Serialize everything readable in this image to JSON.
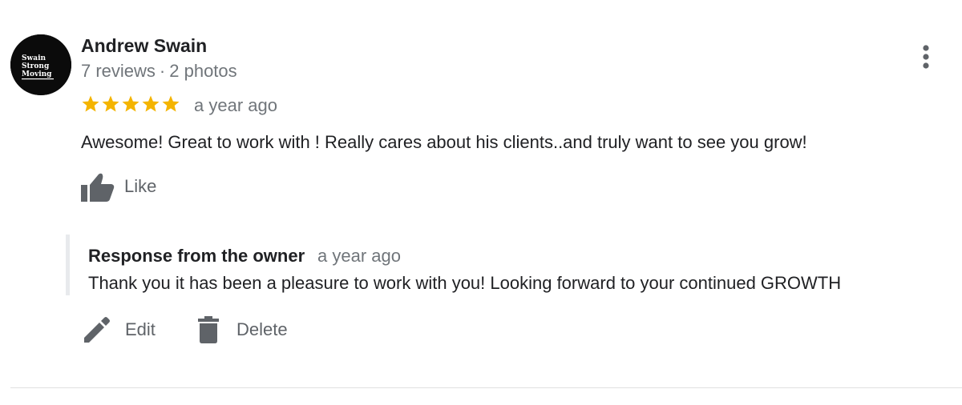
{
  "reviewer": {
    "name": "Andrew Swain",
    "reviews_count": "7 reviews",
    "separator": "·",
    "photos_count": "2 photos",
    "avatar_text": [
      "Swain",
      "Strong",
      "Moving"
    ]
  },
  "review": {
    "rating": 5,
    "rating_max": 5,
    "time": "a year ago",
    "text": "Awesome! Great to work with ! Really cares about his clients..and truly want to see you grow!"
  },
  "actions": {
    "like_label": "Like",
    "edit_label": "Edit",
    "delete_label": "Delete"
  },
  "owner_response": {
    "title": "Response from the owner",
    "time": "a year ago",
    "text": "Thank you it has been a pleasure to work with you! Looking forward to your continued GROWTH"
  },
  "icons": {
    "avatar": "brand-logo",
    "more": "more-vert-icon",
    "star": "star-icon",
    "like": "thumb-up-icon",
    "edit": "pencil-icon",
    "delete": "trash-icon"
  },
  "colors": {
    "star": "#f4b400",
    "icon": "#5f6368",
    "secondary_text": "#70757a",
    "primary_text": "#202124",
    "response_border": "#e8eaed"
  }
}
